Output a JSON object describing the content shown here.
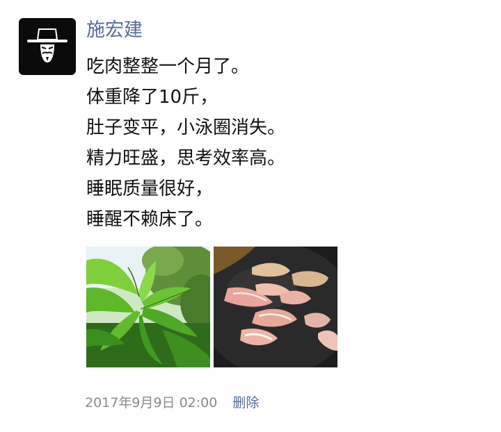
{
  "post": {
    "author": "施宏建",
    "avatar_icon": "masked-man-avatar",
    "lines": [
      "吃肉整整一个月了。",
      "体重降了10斤，",
      "肚子变平，小泳圈消失。",
      "精力旺盛，思考效率高。",
      "睡眠质量很好，",
      "睡醒不赖床了。"
    ],
    "photos": [
      "green-plant-leaves-photo",
      "pork-frying-in-pan-photo"
    ],
    "timestamp": "2017年9月9日 02:00",
    "delete_label": "删除"
  },
  "colors": {
    "link_blue": "#576b95",
    "text_black": "#111111",
    "meta_gray": "#8a8a8a",
    "avatar_bg": "#0b0b0b"
  }
}
